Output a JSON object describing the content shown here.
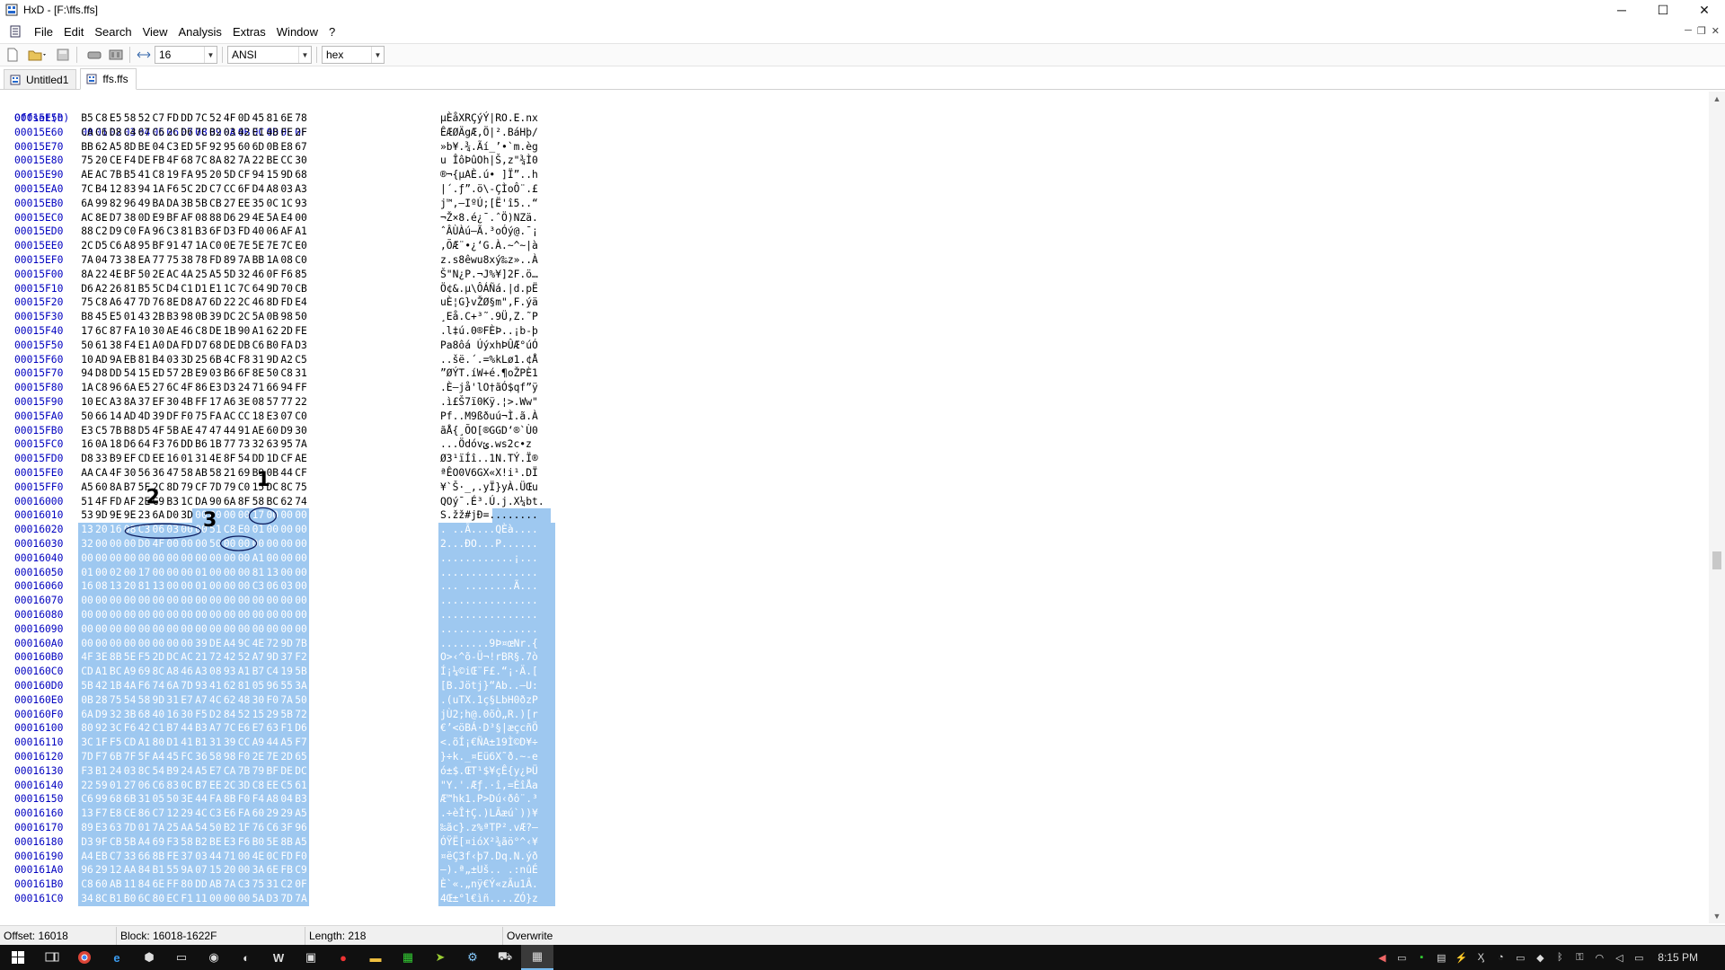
{
  "window": {
    "title": "HxD - [F:\\ffs.ffs]",
    "min": "─",
    "max": "☐",
    "close": "✕"
  },
  "menu": {
    "items": [
      "File",
      "Edit",
      "Search",
      "View",
      "Analysis",
      "Extras",
      "Window",
      "?"
    ]
  },
  "toolbar": {
    "bytes_per_row": "16",
    "charset": "ANSI",
    "offset_base": "hex"
  },
  "tabs": [
    {
      "label": "Untitled1"
    },
    {
      "label": "ffs.ffs"
    }
  ],
  "editor": {
    "header_offset": "Offset(h)",
    "header_cols": [
      "00",
      "01",
      "02",
      "03",
      "04",
      "05",
      "06",
      "07",
      "08",
      "09",
      "0A",
      "0B",
      "0C",
      "0D",
      "0E",
      "0F"
    ],
    "rows": [
      {
        "o": "00015E50",
        "h": "B5 C8 E5 58 52 C7 FD DD 7C 52 4F 0D 45 81 6E 78",
        "a": "µÈåXRÇýÝ|RO.E.nx"
      },
      {
        "o": "00015E60",
        "h": "CA C6 D8 C4 67 C6 2C D6 7C B2 03 42 E1 48 FE 2F",
        "a": "ÊÆØÄgÆ,Ö|².BáHþ/"
      },
      {
        "o": "00015E70",
        "h": "BB 62 A5 8D BE 04 C3 ED 5F 92 95 60 6D 0B E8 67",
        "a": "»b¥.¾.Ãí_’•`m.èg"
      },
      {
        "o": "00015E80",
        "h": "75 20 CE F4 DE FB 4F 68 7C 8A 82 7A 22 BE CC 30",
        "a": "u ÎôÞûOh|Š‚z\"¾Ì0"
      },
      {
        "o": "00015E90",
        "h": "AE AC 7B B5 41 C8 19 FA 95 20 5D CF 94 15 9D 68",
        "a": "®¬{µAÈ.ú• ]Ï”..h"
      },
      {
        "o": "00015EA0",
        "h": "7C B4 12 83 94 1A F6 5C 2D C7 CC 6F D4 A8 03 A3",
        "a": "|´.ƒ”.ö\\-ÇÌoÔ¨.£"
      },
      {
        "o": "00015EB0",
        "h": "6A 99 82 96 49 BA DA 3B 5B CB 27 EE 35 0C 1C 93",
        "a": "j™‚–IºÚ;[Ë'î5..“"
      },
      {
        "o": "00015EC0",
        "h": "AC 8E D7 38 0D E9 BF AF 08 88 D6 29 4E 5A E4 00",
        "a": "¬Ž×8.é¿¯.ˆÖ)NZä."
      },
      {
        "o": "00015ED0",
        "h": "88 C2 D9 C0 FA 96 C3 81 B3 6F D3 FD 40 06 AF A1",
        "a": "ˆÂÙÀú–Ã.³oÓý@.¯¡"
      },
      {
        "o": "00015EE0",
        "h": "2C D5 C6 A8 95 BF 91 47 1A C0 0E 7E 5E 7E 7C E0",
        "a": ",ÕÆ¨•¿‘G.À.~^~|à"
      },
      {
        "o": "00015EF0",
        "h": "7A 04 73 38 EA 77 75 38 78 FD 89 7A BB 1A 08 C0",
        "a": "z.s8êwu8xý‰z»..À"
      },
      {
        "o": "00015F00",
        "h": "8A 22 4E BF 50 2E AC 4A 25 A5 5D 32 46 0F F6 85",
        "a": "Š\"N¿P.¬J%¥]2F.ö…"
      },
      {
        "o": "00015F10",
        "h": "D6 A2 26 81 B5 5C D4 C1 D1 E1 1C 7C 64 9D 70 CB",
        "a": "Ö¢&.µ\\ÔÁÑá.|d.pË"
      },
      {
        "o": "00015F20",
        "h": "75 C8 A6 47 7D 76 8E D8 A7 6D 22 2C 46 8D FD E4",
        "a": "uÈ¦G}vŽØ§m\",F.ýä"
      },
      {
        "o": "00015F30",
        "h": "B8 45 E5 01 43 2B B3 98 0B 39 DC 2C 5A 0B 98 50",
        "a": "¸Eå.C+³˜.9Ü,Z.˜P"
      },
      {
        "o": "00015F40",
        "h": "17 6C 87 FA 10 30 AE 46 C8 DE 1B 90 A1 62 2D FE",
        "a": ".l‡ú.0®FÈÞ..¡b-þ"
      },
      {
        "o": "00015F50",
        "h": "50 61 38 F4 E1 A0 DA FD D7 68 DE DB C6 B0 FA D3",
        "a": "Pa8ôá ÚýxhÞÛÆ°úÓ"
      },
      {
        "o": "00015F60",
        "h": "10 AD 9A EB 81 B4 03 3D 25 6B 4C F8 31 9D A2 C5",
        "a": "..šë.´.=%kLø1.¢Å"
      },
      {
        "o": "00015F70",
        "h": "94 D8 DD 54 15 ED 57 2B E9 03 B6 6F 8E 50 C8 31",
        "a": "”ØÝT.íW+é.¶oŽPÈ1"
      },
      {
        "o": "00015F80",
        "h": "1A C8 96 6A E5 27 6C 4F 86 E3 D3 24 71 66 94 FF",
        "a": ".È–jå'lO†ãÓ$qf”ÿ"
      },
      {
        "o": "00015F90",
        "h": "10 EC A3 8A 37 EF 30 4B FF 17 A6 3E 08 57 77 22",
        "a": ".ì£Š7ï0Kÿ.¦>.Ww\""
      },
      {
        "o": "00015FA0",
        "h": "50 66 14 AD 4D 39 DF F0 75 FA AC CC 18 E3 07 C0",
        "a": "Pf..M9ßðuú¬Ì.ã.À"
      },
      {
        "o": "00015FB0",
        "h": "E3 C5 7B B8 D5 4F 5B AE 47 47 44 91 AE 60 D9 30",
        "a": "ãÅ{¸ÕO[®GGD‘®`Ù0"
      },
      {
        "o": "00015FC0",
        "h": "16 0A 18 D6 64 F3 76 DD B6 1B 77 73 32 63 95 7A",
        "a": "...Ödóvݶ.ws2c•z"
      },
      {
        "o": "00015FD0",
        "h": "D8 33 B9 EF CD EE 16 01 31 4E 8F 54 DD 1D CF AE",
        "a": "Ø3¹ïÍî..1N.TÝ.Ï®"
      },
      {
        "o": "00015FE0",
        "h": "AA CA 4F 30 56 36 47 58 AB 58 21 69 B9 0B 44 CF",
        "a": "ªÊO0V6GX«X!i¹.DÏ"
      },
      {
        "o": "00015FF0",
        "h": "A5 60 8A B7 5F 2C 8D 79 CF 7D 79 C0 15 DC 8C 75",
        "a": "¥`Š·_,.yÏ}yÀ.ÜŒu"
      },
      {
        "o": "00016000",
        "h": "51 4F FD AF 2E C9 B3 1C DA 90 6A 8F 58 BC 62 74",
        "a": "QOý¯.É³.Ú.j.X¼bt."
      },
      {
        "o": "00016010",
        "h": "53 9D 9E 9E 23 6A D0 3D 00 00 00 00 17 00 00 00",
        "a": "S.žž#jÐ=........"
      },
      {
        "o": "00016020",
        "h": "13 20 16 08 C3 06 03 00 00 51 C8 E0 01 00 00 00",
        "a": ". ..Ã....QÈà...."
      },
      {
        "o": "00016030",
        "h": "32 00 00 00 D0 4F 00 00 00 50 00 00 00 00 00 00",
        "a": "2...ÐO...P......"
      },
      {
        "o": "00016040",
        "h": "00 00 00 00 00 00 00 00 00 00 00 00 A1 00 00 00",
        "a": "............¡..."
      },
      {
        "o": "00016050",
        "h": "01 00 02 00 17 00 00 00 01 00 00 00 81 13 00 00",
        "a": "................"
      },
      {
        "o": "00016060",
        "h": "16 08 13 20 81 13 00 00 01 00 00 00 C3 06 03 00",
        "a": "... ........Ã..."
      },
      {
        "o": "00016070",
        "h": "00 00 00 00 00 00 00 00 00 00 00 00 00 00 00 00",
        "a": "................"
      },
      {
        "o": "00016080",
        "h": "00 00 00 00 00 00 00 00 00 00 00 00 00 00 00 00",
        "a": "................"
      },
      {
        "o": "00016090",
        "h": "00 00 00 00 00 00 00 00 00 00 00 00 00 00 00 00",
        "a": "................"
      },
      {
        "o": "000160A0",
        "h": "00 00 00 00 00 00 00 00 39 DE A4 9C 4E 72 9D 7B",
        "a": "........9Þ¤œNr.{"
      },
      {
        "o": "000160B0",
        "h": "4F 3E 8B 5E F5 2D DC AC 21 72 42 52 A7 9D 37 F2",
        "a": "O>‹^õ-Ü¬!rBR§.7ò"
      },
      {
        "o": "000160C0",
        "h": "CD A1 BC A9 69 8C A8 46 A3 08 93 A1 B7 C4 19 5B",
        "a": "Í¡¼©iŒ¨F£.“¡·Ä.["
      },
      {
        "o": "000160D0",
        "h": "5B 42 1B 4A F6 74 6A 7D 93 41 62 81 05 96 55 3A",
        "a": "[B.Jötj}“Ab..–U:"
      },
      {
        "o": "000160E0",
        "h": "0B 28 75 54 58 9D 31 E7 A7 4C 62 48 30 F0 7A 50",
        "a": ".(uTX.1ç§LbH0ðzP"
      },
      {
        "o": "000160F0",
        "h": "6A D9 32 3B 68 40 16 30 F5 D2 84 52 15 29 5B 72",
        "a": "jÙ2;h@.0õÒ„R.)[r"
      },
      {
        "o": "00016100",
        "h": "80 92 3C F6 42 C1 B7 44 B3 A7 7C E6 E7 63 F1 D6",
        "a": "€’<öBÁ·D³§|æçcñÖ"
      },
      {
        "o": "00016110",
        "h": "3C 1F F5 CD A1 80 D1 41 B1 31 39 CC A9 44 A5 F7",
        "a": "<.õÍ¡€ÑA±19Ì©D¥÷"
      },
      {
        "o": "00016120",
        "h": "7D F7 6B 7F 5F A4 45 FC 36 58 98 F0 2E 7E 2D 65",
        "a": "}÷k._¤Eü6X˜ð.~-e"
      },
      {
        "o": "00016130",
        "h": "F3 B1 24 03 8C 54 B9 24 A5 E7 CA 7B 79 BF DE DC",
        "a": "ó±$.ŒT¹$¥çÊ{y¿ÞÜ"
      },
      {
        "o": "00016140",
        "h": "22 59 01 27 06 C6 83 0C B7 EE 2C 3D C8 EE C5 61",
        "a": "\"Y.'.Æƒ.·î,=ÈîÅa"
      },
      {
        "o": "00016150",
        "h": "C6 99 68 6B 31 05 50 3E 44 FA 8B F0 F4 A8 04 B3",
        "a": "Æ™hk1.P>Dú‹ðô¨.³"
      },
      {
        "o": "00016160",
        "h": "13 F7 E8 CE 86 C7 12 29 4C C3 E6 FA 60 29 29 A5",
        "a": ".÷èÎ†Ç.)LÃæú`))¥"
      },
      {
        "o": "00016170",
        "h": "89 E3 63 7D 01 7A 25 AA 54 50 B2 1F 76 C6 3F 96",
        "a": "‰ãc}.z%ªTP².vÆ?–"
      },
      {
        "o": "00016180",
        "h": "D3 9F CB 5B A4 69 F3 58 B2 BE E3 F6 B0 5E 8B A5",
        "a": "ÓŸË[¤ióX²¾ãö°^‹¥"
      },
      {
        "o": "00016190",
        "h": "A4 EB C7 33 66 8B FE 37 03 44 71 00 4E 0C FD F0",
        "a": "¤ëÇ3f‹þ7.Dq.N.ýð"
      },
      {
        "o": "000161A0",
        "h": "96 29 12 AA 84 B1 55 9A 07 15 20 00 3A 6E FB C9",
        "a": "–).ª„±Uš.. .:nûÉ"
      },
      {
        "o": "000161B0",
        "h": "C8 60 AB 11 84 6E FF 80 DD AB 7A C3 75 31 C2 0F",
        "a": "È`«.„nÿ€Ý«zÃu1Â."
      },
      {
        "o": "000161C0",
        "h": "34 8C B1 B0 6C 80 EC F1 11 00 00 00 5A D3 7D 7A",
        "a": "4Œ±°l€ìñ....ZÓ}z"
      }
    ],
    "annotations": [
      "1",
      "2",
      "3"
    ]
  },
  "status": {
    "offset": "Offset: 16018",
    "block": "Block: 16018-1622F",
    "length": "Length: 218",
    "mode": "Overwrite"
  },
  "taskbar": {
    "clock": "8:15 PM"
  }
}
